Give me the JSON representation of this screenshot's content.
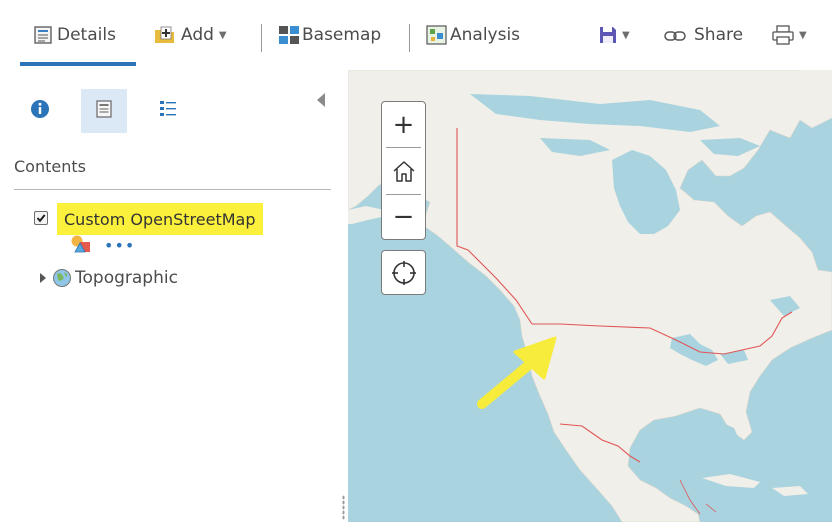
{
  "toolbar": {
    "details_label": "Details",
    "add_label": "Add",
    "basemap_label": "Basemap",
    "analysis_label": "Analysis",
    "share_label": "Share"
  },
  "panel": {
    "contents_title": "Contents",
    "layers": [
      {
        "label": "Custom OpenStreetMap",
        "checked": true,
        "highlight_color": "#fbf03b"
      },
      {
        "label": "Topographic",
        "checked": false
      }
    ],
    "more_options": "•••"
  },
  "map": {
    "zoom_in_symbol": "+",
    "zoom_out_symbol": "−",
    "water_color": "#a9d3de",
    "land_color": "#f1efe9",
    "border_color": "#e05555",
    "arrow_color": "#f7ec3c"
  },
  "colors": {
    "accent": "#2b74b8",
    "highlight": "#fbf03b"
  }
}
